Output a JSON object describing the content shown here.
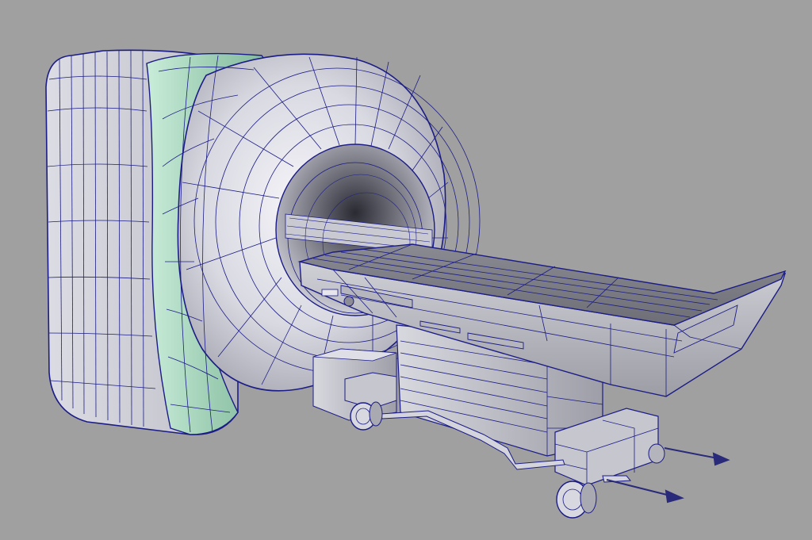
{
  "viewport": {
    "background": "#a0a0a0",
    "wire_color": "#1c1c86",
    "shade_light": "#e8e8ee",
    "shade_mid": "#b9b9c2",
    "shade_dark": "#6d6d76",
    "accent_green": "#9fcfb5",
    "arrow_color": "#2a2a7a"
  },
  "scene": {
    "objects": [
      "ct-gantry-model",
      "patient-table-model",
      "table-base-model",
      "caster-wheels",
      "direction-arrows"
    ]
  }
}
